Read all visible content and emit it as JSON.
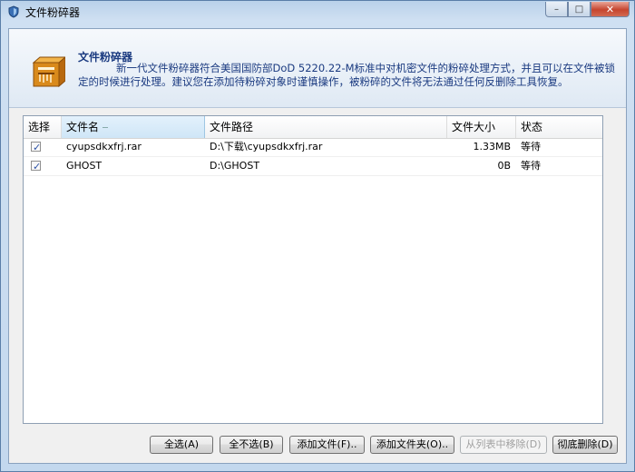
{
  "window": {
    "title": "文件粉碎器",
    "controls": {
      "minimize": "–",
      "maximize": "□",
      "close": "✕"
    }
  },
  "header": {
    "title": "文件粉碎器",
    "description": "新一代文件粉碎器符合美国国防部DoD 5220.22-M标准中对机密文件的粉碎处理方式，并且可以在文件被锁定的时候进行处理。建议您在添加待粉碎对象时谨慎操作，被粉碎的文件将无法通过任何反删除工具恢复。"
  },
  "table": {
    "columns": {
      "select": "选择",
      "name": "文件名",
      "path": "文件路径",
      "size": "文件大小",
      "status": "状态"
    },
    "rows": [
      {
        "checked": true,
        "check_glyph": "✓",
        "name": "cyupsdkxfrj.rar",
        "path": "D:\\下载\\cyupsdkxfrj.rar",
        "size": "1.33MB",
        "status": "等待"
      },
      {
        "checked": true,
        "check_glyph": "✓",
        "name": "GHOST",
        "path": "D:\\GHOST",
        "size": "0B",
        "status": "等待"
      }
    ]
  },
  "buttons": {
    "select_all": "全选(A)",
    "select_none": "全不选(B)",
    "add_file": "添加文件(F)..",
    "add_folder": "添加文件夹(O)..",
    "remove_from_list": "从列表中移除(D)",
    "shred": "彻底删除(D)"
  },
  "colors": {
    "header_text": "#1a3a80",
    "check": "#2a4fa3",
    "close_button": "#c6452f"
  }
}
